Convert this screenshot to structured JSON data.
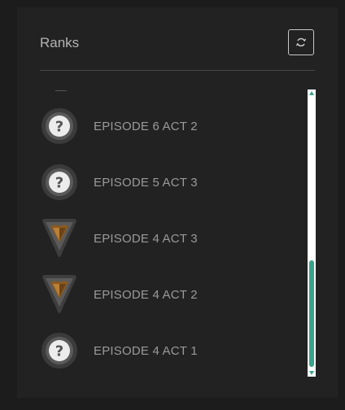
{
  "header": {
    "title": "Ranks",
    "refresh_icon": "refresh-icon"
  },
  "colors": {
    "background": "#1c1c1c",
    "panel": "#222222",
    "accent": "#3aa38a",
    "text": "#9a9a9a"
  },
  "ranks": [
    {
      "label": "EPISODE 6 ACT 2",
      "icon": "unranked-question-icon"
    },
    {
      "label": "EPISODE 5 ACT 3",
      "icon": "unranked-question-icon"
    },
    {
      "label": "EPISODE 4 ACT 3",
      "icon": "bronze-rank-icon"
    },
    {
      "label": "EPISODE 4 ACT 2",
      "icon": "bronze-rank-icon"
    },
    {
      "label": "EPISODE 4 ACT 1",
      "icon": "unranked-question-icon"
    }
  ]
}
